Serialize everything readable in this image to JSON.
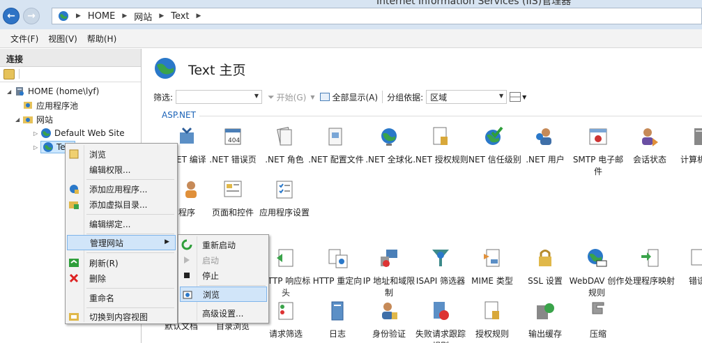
{
  "window": {
    "title": "Internet Information Services (IIS)管理器"
  },
  "address": {
    "crumbs": [
      "HOME",
      "网站",
      "Text"
    ]
  },
  "menu": {
    "items": [
      "文件(F)",
      "视图(V)",
      "帮助(H)"
    ]
  },
  "connections": {
    "header": "连接",
    "tree": {
      "server": "HOME (home\\lyf)",
      "app_pools": "应用程序池",
      "sites": "网站",
      "default_site": "Default Web Site",
      "text_site": "Text"
    }
  },
  "main": {
    "title": "Text 主页",
    "filter": {
      "label": "筛选:",
      "start": "开始(G)",
      "show_all": "全部显示(A)",
      "group_by_label": "分组依据:",
      "group_by_value": "区域"
    },
    "section": "ASP.NET",
    "features_row1": [
      ".NET 编译",
      ".NET 错误页",
      ".NET 角色",
      ".NET 配置文件",
      ".NET 全球化",
      ".NET 授权规则",
      ".NET 信任级别",
      ".NET 用户",
      "SMTP 电子邮件",
      "会话状态",
      "计算机"
    ],
    "features_row2": [
      "程序",
      "页面和控件",
      "应用程序设置"
    ],
    "features_row3": [
      "HTTP 响应标头",
      "HTTP 重定向",
      "IP 地址和域限制",
      "ISAPI 筛选器",
      "MIME 类型",
      "SSL 设置",
      "WebDAV 创作规则",
      "处理程序映射",
      "错误"
    ],
    "features_row4": [
      "默认文档",
      "目录浏览",
      "请求筛选",
      "日志",
      "身份验证",
      "失败请求跟踪规则",
      "授权规则",
      "输出缓存",
      "压缩"
    ]
  },
  "context_menu": {
    "items": [
      "浏览",
      "编辑权限...",
      "添加应用程序...",
      "添加虚拟目录...",
      "编辑绑定...",
      "管理网站",
      "刷新(R)",
      "删除",
      "重命名",
      "切换到内容视图"
    ]
  },
  "submenu": {
    "items": [
      "重新启动",
      "启动",
      "停止",
      "浏览",
      "高级设置..."
    ]
  },
  "colors": {
    "accent": "#1a62b7",
    "highlight": "#d1e5f9",
    "titlebar": "#d7e4f2"
  }
}
